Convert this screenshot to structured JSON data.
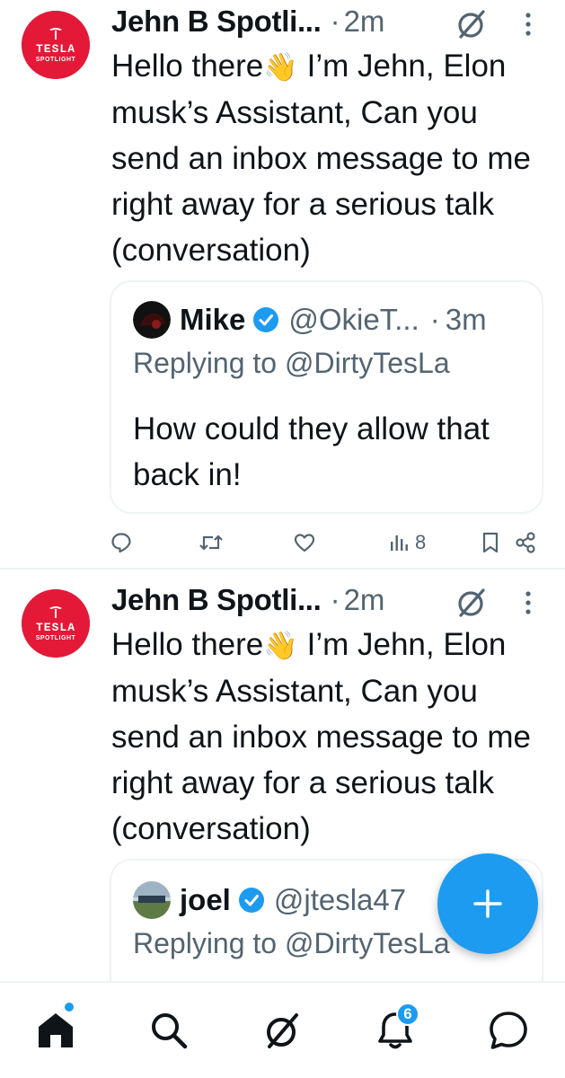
{
  "tweets": [
    {
      "author": "Jehn B Spotli...",
      "separator": "·",
      "time": "2m",
      "avatar_text": "TESLA",
      "avatar_subtext": "SPOTLIGHT",
      "text_before_emoji": "Hello there",
      "emoji": "👋",
      "text_after_emoji": " I’m Jehn, Elon musk’s Assistant, Can you send an inbox message to me right away for a serious talk (conversation)",
      "quote": {
        "name": "Mike",
        "handle": "@OkieT...",
        "separator": "·",
        "time": "3m",
        "replying_to": "Replying to @DirtyTesLa",
        "text": "How could they allow that back in!"
      },
      "views_count": "8"
    },
    {
      "author": "Jehn B Spotli...",
      "separator": "·",
      "time": "2m",
      "avatar_text": "TESLA",
      "avatar_subtext": "SPOTLIGHT",
      "text_before_emoji": "Hello there",
      "emoji": "👋",
      "text_after_emoji": " I’m Jehn, Elon musk’s Assistant, Can you send an inbox message to me right away for a serious talk (conversation)",
      "quote": {
        "name": "joel",
        "handle": "@jtesla47",
        "replying_to": "Replying to @DirtyTesLa"
      }
    }
  ],
  "fab": {
    "icon": "plus-icon"
  },
  "bottom_nav": {
    "items": [
      "home-icon",
      "search-icon",
      "grok-icon",
      "notifications-icon",
      "messages-icon"
    ],
    "notifications_badge": "6"
  },
  "colors": {
    "accent": "#1d9bf0",
    "secondary_text": "#536471",
    "tesla_red": "#e31937"
  }
}
